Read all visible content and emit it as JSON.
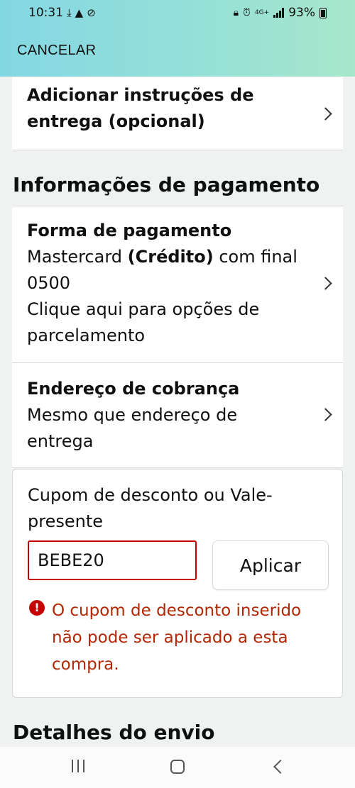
{
  "status_bar": {
    "time": "10:31",
    "left_icons": [
      "download-icon",
      "warning-icon",
      "blocked-icon"
    ],
    "network": "4G+",
    "battery": "93%"
  },
  "header": {
    "cancel_label": "CANCELAR"
  },
  "delivery_instructions": {
    "label": "Adicionar instruções de entrega (opcional)"
  },
  "payment": {
    "section_title": "Informações de pagamento",
    "method_title": "Forma de pagamento",
    "method_brand": "Mastercard",
    "method_type": "(Crédito)",
    "method_suffix": "com final 0500",
    "installments": "Clique aqui para opções de parcelamento",
    "billing_title": "Endereço de cobrança",
    "billing_value": "Mesmo que endereço de entrega"
  },
  "coupon": {
    "label": "Cupom de desconto ou Vale-presente",
    "value": "BEBE20",
    "apply_label": "Aplicar",
    "error": "O cupom de desconto inserido não pode ser aplicado a esta compra."
  },
  "shipping": {
    "section_title": "Detalhes do envio"
  }
}
